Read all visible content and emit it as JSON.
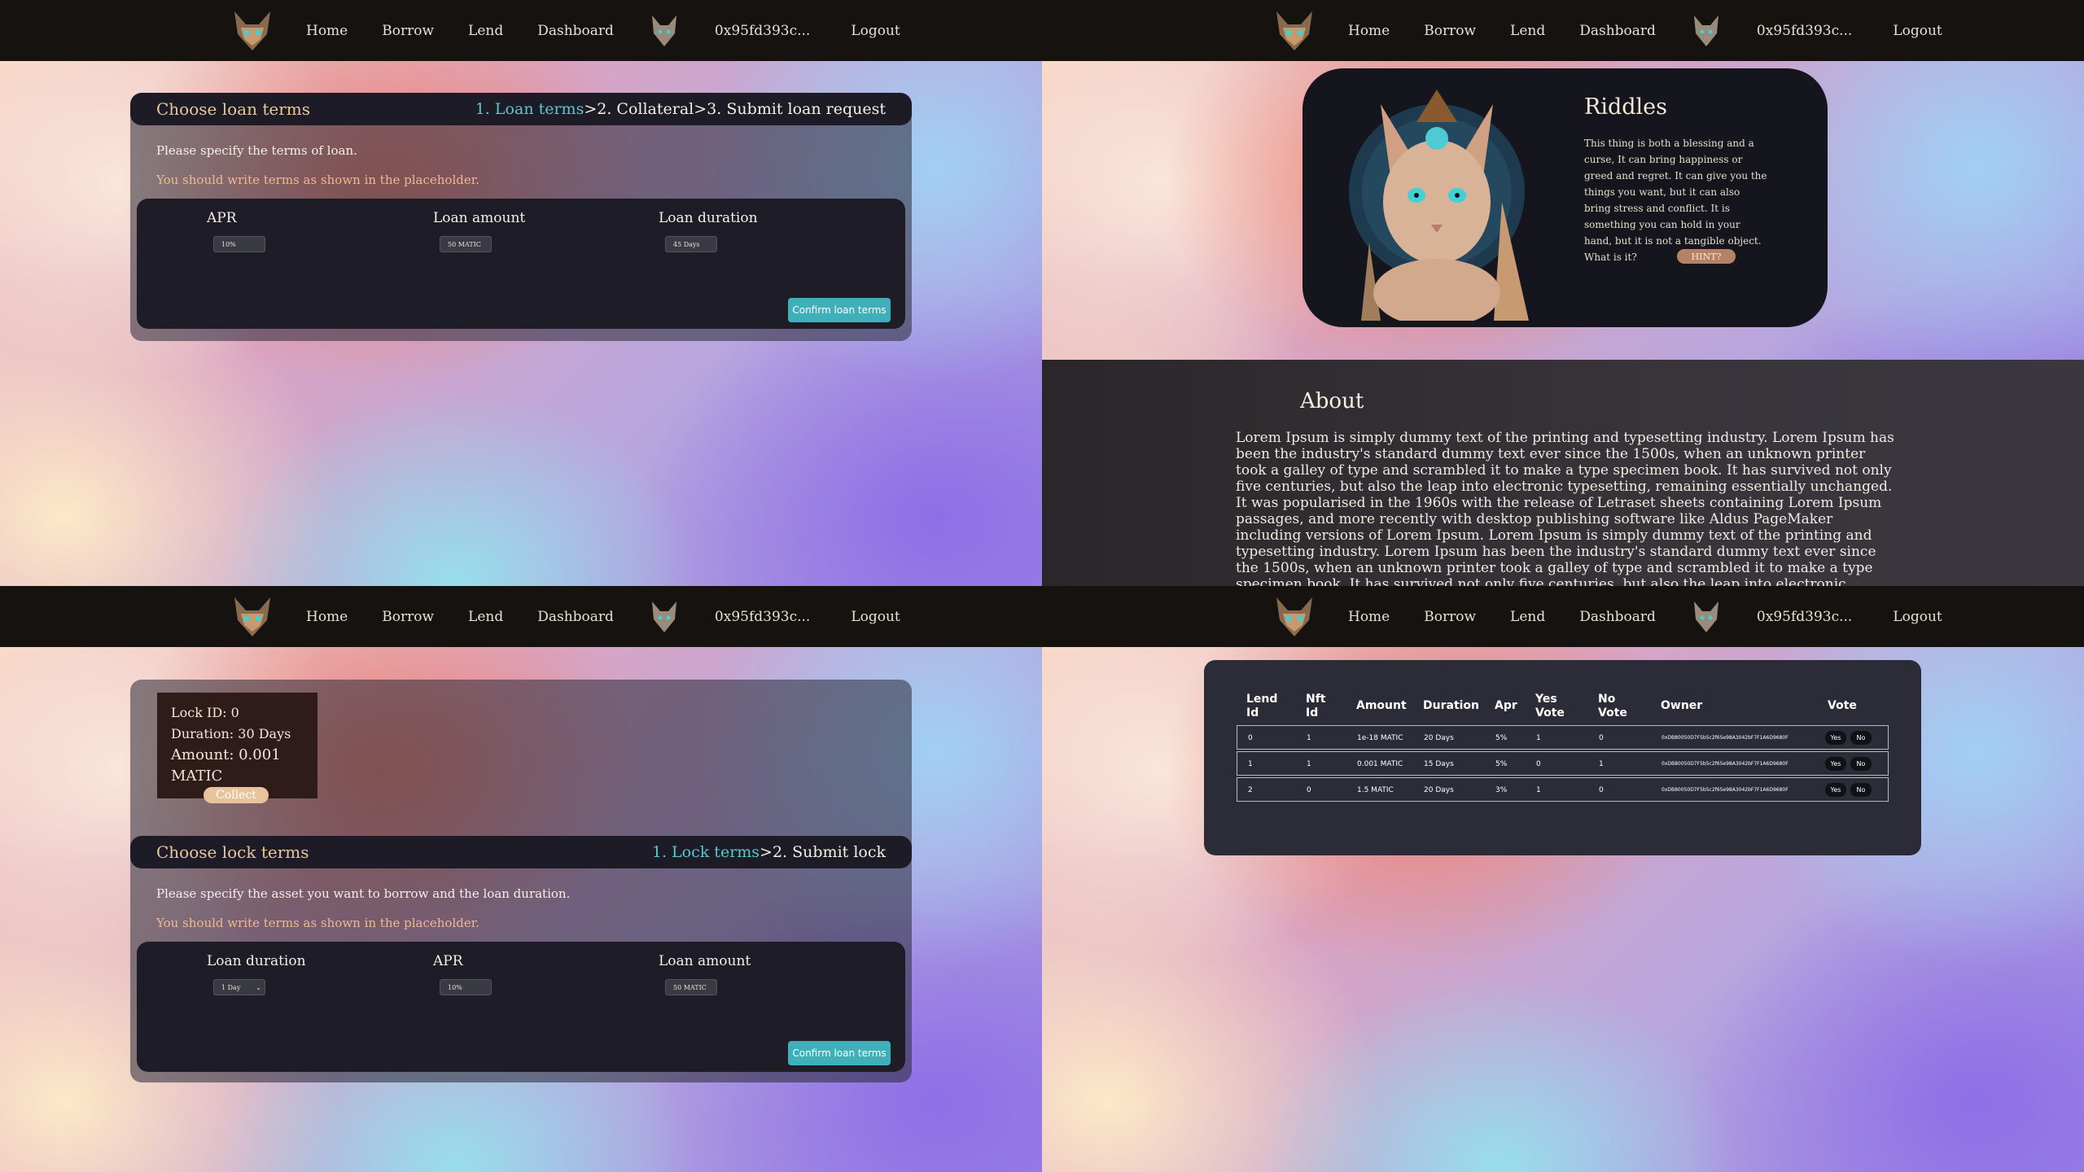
{
  "nav": {
    "items": [
      "Home",
      "Borrow",
      "Lend",
      "Dashboard"
    ],
    "wallet": "0x95fd393c...",
    "logout": "Logout"
  },
  "borrow": {
    "card_title": "Choose loan terms",
    "step1": "1. Loan terms",
    "step_rest": ">2. Collateral>3. Submit loan request",
    "description": "Please specify the terms of loan.",
    "hint": "You should write terms as shown in the placeholder.",
    "fields": [
      {
        "label": "APR",
        "value": "10%"
      },
      {
        "label": "Loan amount",
        "value": "50 MATIC"
      },
      {
        "label": "Loan duration",
        "value": "45 Days"
      }
    ],
    "confirm": "Confirm loan terms"
  },
  "home": {
    "riddle_title": "Riddles",
    "riddle_text": "This thing is both a blessing and a curse, It can bring happiness or greed and regret. It can give you the things you want, but it can also bring stress and conflict. It is something you can hold in your hand, but it is not a tangible object. What is it?",
    "hint_button": "HINT?",
    "about_title": "About",
    "about_text": "Lorem Ipsum is simply dummy text of the printing and typesetting industry. Lorem Ipsum has been the industry's standard dummy text ever since the 1500s, when an unknown printer took a galley of type and scrambled it to make a type specimen book. It has survived not only five centuries, but also the leap into electronic typesetting, remaining essentially unchanged. It was popularised in the 1960s with the release of Letraset sheets containing Lorem Ipsum passages, and more recently with desktop publishing software like Aldus PageMaker including versions of Lorem Ipsum. Lorem Ipsum is simply dummy text of the printing and typesetting industry. Lorem Ipsum has been the industry's standard dummy text ever since the 1500s, when an unknown printer took a galley of type and scrambled it to make a type specimen book. It has survived not only five centuries, but also the leap into electronic typesetting, remaining essentially unchanged. It was popularised in the 1960s with the release of Letraset sheets containing Lorem Ipsum"
  },
  "lock": {
    "lock_id": "Lock ID: 0",
    "duration": "Duration: 30 Days",
    "amount": "Amount: 0.001 MATIC",
    "collect": "Collect",
    "card_title": "Choose lock terms",
    "step1": "1. Lock terms",
    "step_rest": ">2. Submit lock",
    "description": "Please specify the asset you want to borrow and the loan duration.",
    "hint": "You should write terms as shown in the placeholder.",
    "fields": [
      {
        "label": "Loan duration",
        "value": "1 Day"
      },
      {
        "label": "APR",
        "value": "10%"
      },
      {
        "label": "Loan amount",
        "value": "50 MATIC"
      }
    ],
    "confirm": "Confirm loan terms"
  },
  "votes": {
    "headers": [
      "Lend Id",
      "Nft Id",
      "Amount",
      "Duration",
      "Apr",
      "Yes Vote",
      "No Vote",
      "Owner",
      "Vote"
    ],
    "rows": [
      {
        "lend_id": "0",
        "nft_id": "1",
        "amount": "1e-18 MATIC",
        "duration": "20 Days",
        "apr": "5%",
        "yes": "1",
        "no": "0",
        "owner": "0xDB80050D7F5b5c2f65e98A3042bF7F1A6D9680F"
      },
      {
        "lend_id": "1",
        "nft_id": "1",
        "amount": "0.001 MATIC",
        "duration": "15 Days",
        "apr": "5%",
        "yes": "0",
        "no": "1",
        "owner": "0xDB80050D7F5b5c2f65e98A3042bF7F1A6D9680F"
      },
      {
        "lend_id": "2",
        "nft_id": "0",
        "amount": "1.5 MATIC",
        "duration": "20 Days",
        "apr": "3%",
        "yes": "1",
        "no": "0",
        "owner": "0xDB80050D7F5b5c2f65e98A3042bF7F1A6D9680F"
      }
    ],
    "yes_label": "Yes",
    "no_label": "No"
  },
  "colors": {
    "accent": "#3fb0ba",
    "nav_bg": "#151210",
    "gold": "#e8c79d",
    "collect": "#e8c39b"
  }
}
